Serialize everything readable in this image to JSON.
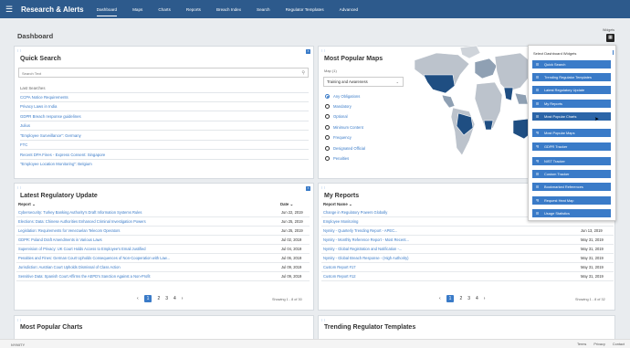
{
  "brand": "Research & Alerts",
  "nav": [
    "Dashboard",
    "Maps",
    "Charts",
    "Reports",
    "Breach Index",
    "Search",
    "Regulator Templates",
    "Advanced"
  ],
  "page_title": "Dashboard",
  "widgets_label": "Widgets",
  "quick_search": {
    "title": "Quick Search",
    "placeholder": "Search Text",
    "last_searches_label": "Last Searches",
    "items": [
      "CCPA Notice Requirements",
      "Privacy Laws in India",
      "GDPR Breach response guidelines",
      "Julius",
      "\"Employee Surveillance\": Germany",
      "FTC",
      "Recent DPA Fines - Express Consent: Singapore",
      "\"Employee Location Monitoring\": Belgium"
    ]
  },
  "popular_maps": {
    "title": "Most Popular Maps",
    "map_label": "Map (1)",
    "select_value": "Training and Awareness",
    "options": [
      "Any Obligations",
      "Mandatory",
      "Optional",
      "Minimum Content",
      "Frequency",
      "Designated Official",
      "Penalties"
    ],
    "selected_index": 0
  },
  "latest_update": {
    "title": "Latest Regulatory Update",
    "col_report": "Report",
    "col_date": "Date",
    "rows": [
      [
        "Cybersecurity: Turkey Banking Authority's Draft Information Systems Rules",
        "Jun 22, 2019"
      ],
      [
        "Elections: Data: Chinese Authorities Enhanced Criminal Investigation Powers",
        "Jun 25, 2019"
      ],
      [
        "Legislation: Requirements for Venezuelan Telecom Operators",
        "Jun 25, 2019"
      ],
      [
        "GDPR: Poland Draft Amendments in Various Laws",
        "Jul 02, 2019"
      ],
      [
        "Supervision of Privacy: UK Court Holds Access to Employee's Email Justified",
        "Jul 04, 2019"
      ],
      [
        "Penalties and Fines: German Court Upholds Consequences of Non-Cooperation with Law...",
        "Jul 06, 2019"
      ],
      [
        "Jurisdiction: Austrian Court Upholds Dismissal of Class Action",
        "Jul 09, 2019"
      ],
      [
        "Sensitive Data: Spanish Court Affirms the AEPD's Sanction Against a Non-Profit",
        "Jul 09, 2019"
      ]
    ],
    "pages": [
      "1",
      "2",
      "3",
      "4"
    ],
    "showing": "Showing 1 - 8 of 30"
  },
  "my_reports": {
    "title": "My Reports",
    "col_report": "Report Name",
    "col_date": "Date",
    "rows": [
      [
        "Change in Regulatory Powers Globally",
        ""
      ],
      [
        "Employee Monitoring",
        ""
      ],
      [
        "Nymity - Quarterly Trending Report - APEC...",
        "Jun 13, 2019"
      ],
      [
        "Nymity - Monthly Reference Report - Most Recent...",
        "May 31, 2019"
      ],
      [
        "Nymity - Global Registration and Notification -...",
        "May 31, 2019"
      ],
      [
        "Nymity - Global Breach Response - (High Authority)",
        "May 31, 2019"
      ],
      [
        "Custom Report #17",
        "May 31, 2019"
      ],
      [
        "Custom Report #12",
        "May 31, 2019"
      ]
    ],
    "pages": [
      "1",
      "2",
      "3",
      "4"
    ],
    "showing": "Showing 1 - 8 of 32"
  },
  "popular_charts": {
    "title": "Most Popular Charts"
  },
  "trending_templates": {
    "title": "Trending Regulator Templates"
  },
  "dropdown": {
    "title": "Select Dashboard Widgets",
    "items": [
      {
        "label": "Quick Search",
        "icon": "list-icon"
      },
      {
        "label": "Trending Regulator Templates",
        "icon": "list-icon"
      },
      {
        "label": "Latest Regulatory Update",
        "icon": "list-icon"
      },
      {
        "label": "My Reports",
        "icon": "list-icon"
      },
      {
        "label": "Most Popular Charts",
        "icon": "list-icon"
      },
      {
        "label": "Most Popular Maps",
        "icon": "tracker-icon"
      },
      {
        "label": "GDPR Tracker",
        "icon": "tracker-icon"
      },
      {
        "label": "NIST Tracker",
        "icon": "tracker-icon"
      },
      {
        "label": "Custom Tracker",
        "icon": "list-icon"
      },
      {
        "label": "Bookmarked References",
        "icon": "list-icon"
      },
      {
        "label": "Request Heat Map",
        "icon": "tracker-icon"
      },
      {
        "label": "Usage Statistics",
        "icon": "list-icon"
      }
    ]
  },
  "footer": {
    "copyright": "NYMITY",
    "links": [
      "Terms",
      "Privacy",
      "Contact"
    ]
  }
}
